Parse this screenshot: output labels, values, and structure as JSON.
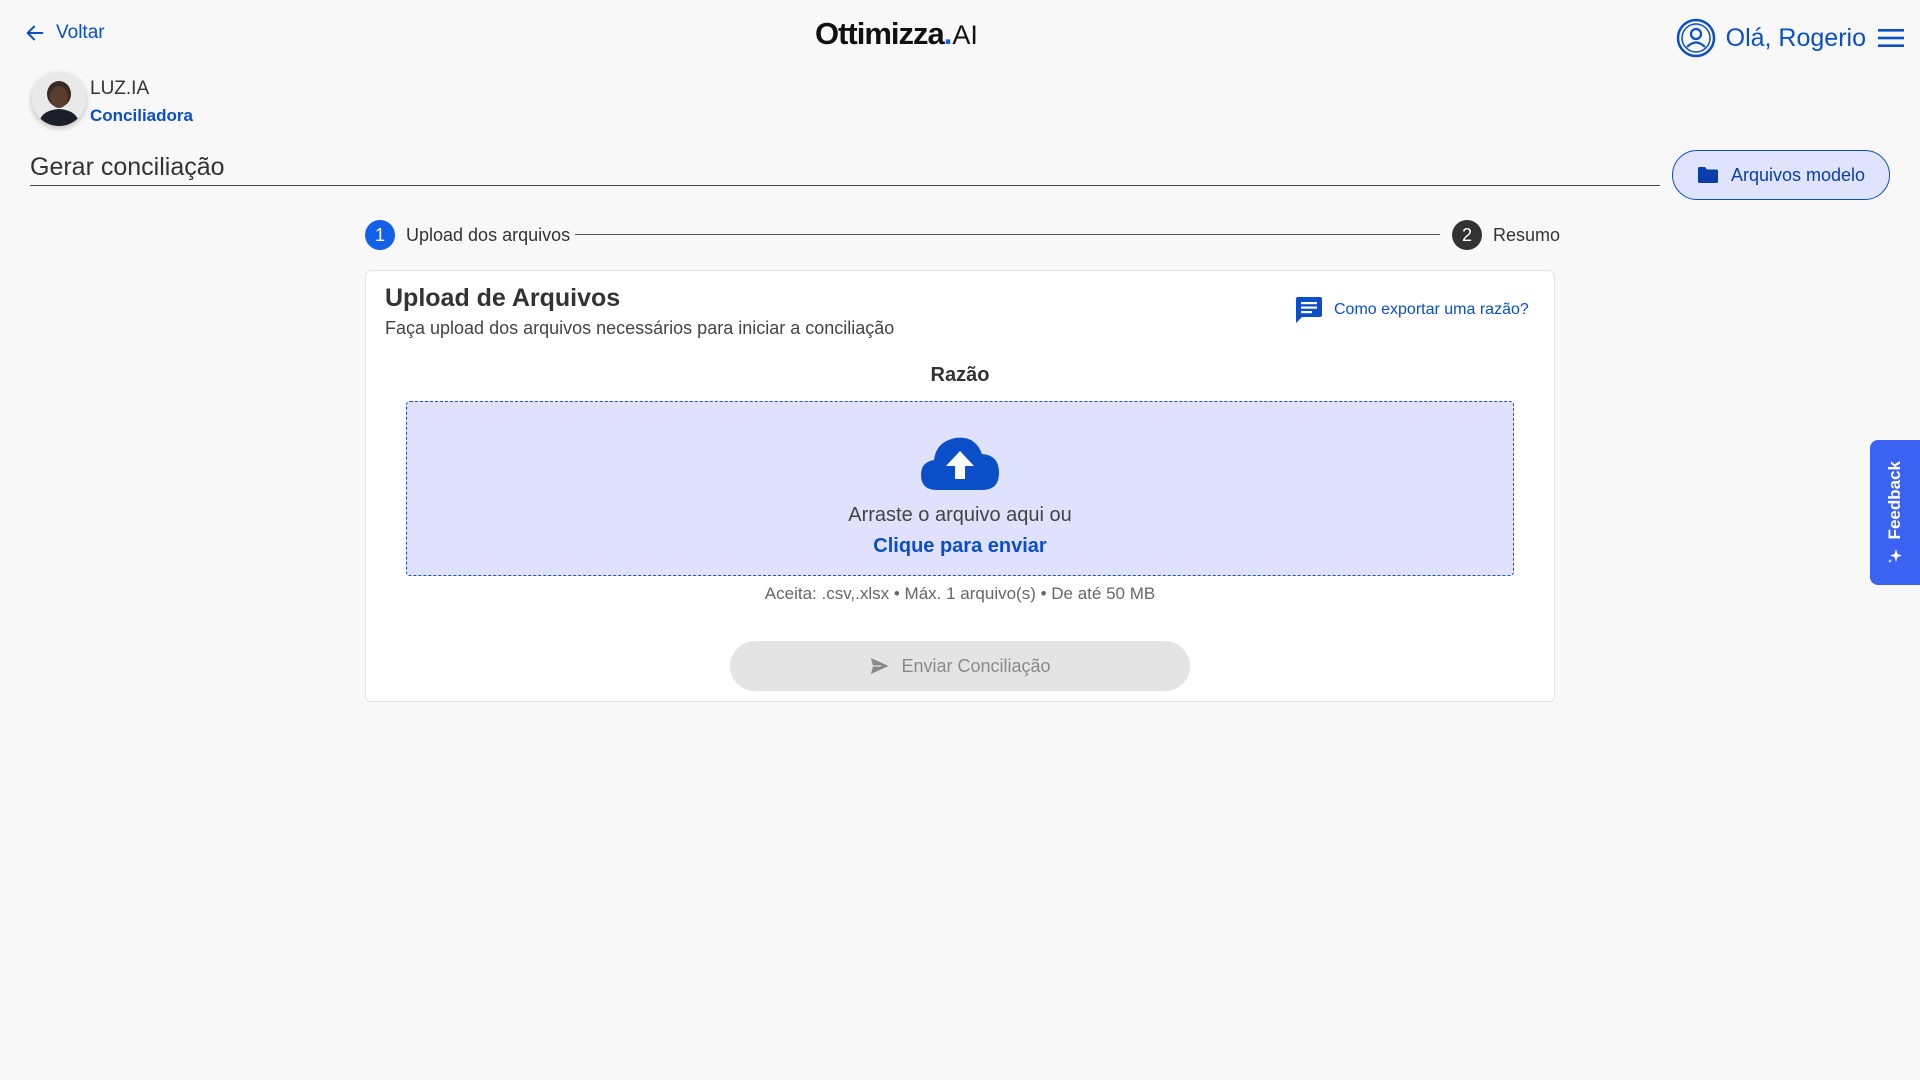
{
  "header": {
    "back_label": "Voltar",
    "logo_word": "Ottimizza",
    "logo_dot": ".",
    "logo_ai": "AI",
    "greeting": "Olá, Rogerio"
  },
  "profile": {
    "name": "LUZ.IA",
    "role": "Conciliadora"
  },
  "page": {
    "title": "Gerar conciliação",
    "models_button": "Arquivos modelo"
  },
  "stepper": {
    "steps": [
      {
        "number": "1",
        "label": "Upload dos arquivos",
        "state": "active"
      },
      {
        "number": "2",
        "label": "Resumo",
        "state": "pending"
      }
    ]
  },
  "card": {
    "title": "Upload de Arquivos",
    "subtitle": "Faça upload dos arquivos necessários para iniciar a conciliação",
    "help_link": "Como exportar uma razão?",
    "section_label": "Razão",
    "dropzone_text": "Arraste o arquivo aqui ou",
    "dropzone_link": "Clique para enviar",
    "accepts": "Aceita: .csv,.xlsx • Máx. 1 arquivo(s) • De até 50 MB",
    "submit_label": "Enviar Conciliação"
  },
  "feedback": {
    "label": "Feedback"
  },
  "colors": {
    "primary": "#0a4fc7",
    "accent": "#1560e8",
    "dropzone_bg": "#dfe1fd",
    "feedback_bg": "#3b63f3"
  },
  "icons": [
    "arrow-left-icon",
    "user-circle-icon",
    "menu-icon",
    "folder-icon",
    "chat-icon",
    "cloud-upload-icon",
    "send-icon",
    "sparkle-icon"
  ]
}
